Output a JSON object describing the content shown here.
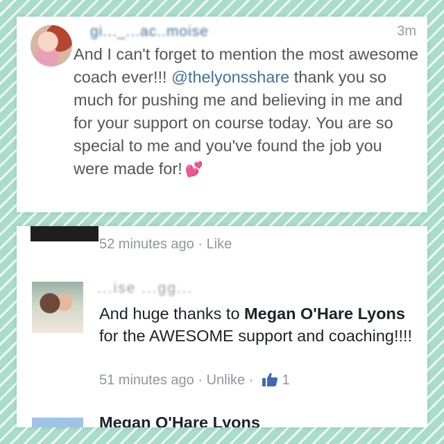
{
  "instagram": {
    "username": "gi..._...ac..moise",
    "timestamp": "3m",
    "comment_before": "And I can't forget to mention the most awesome coach ever!!! ",
    "mention": "@thelyonsshare",
    "comment_after": " thank you so much for pushing me and believing in me and for your support on course today. You are so special to me and you've found the job you were made for!",
    "emoji": "💕"
  },
  "facebook": {
    "first_meta": {
      "time": "52 minutes ago",
      "separator": "·",
      "action": "Like"
    },
    "comment": {
      "author": "...ise ...gg...",
      "text_before": "And huge thanks to ",
      "tagged_name": "Megan O'Hare Lyons",
      "text_after": " for the AWESOME support and coaching!!!!"
    },
    "second_meta": {
      "time": "51 minutes ago",
      "separator": "·",
      "action": "Unlike",
      "separator2": "·",
      "like_count": "1"
    },
    "next_author": "Megan O'Hare Lyons"
  },
  "colors": {
    "instagram_link": "#3f729b",
    "facebook_text": "#1d2129",
    "facebook_meta": "#90949c",
    "facebook_like_blue": "#4267b2",
    "background_mint": "#a8dccb"
  },
  "icons": {
    "like": "thumbs-up-icon"
  }
}
